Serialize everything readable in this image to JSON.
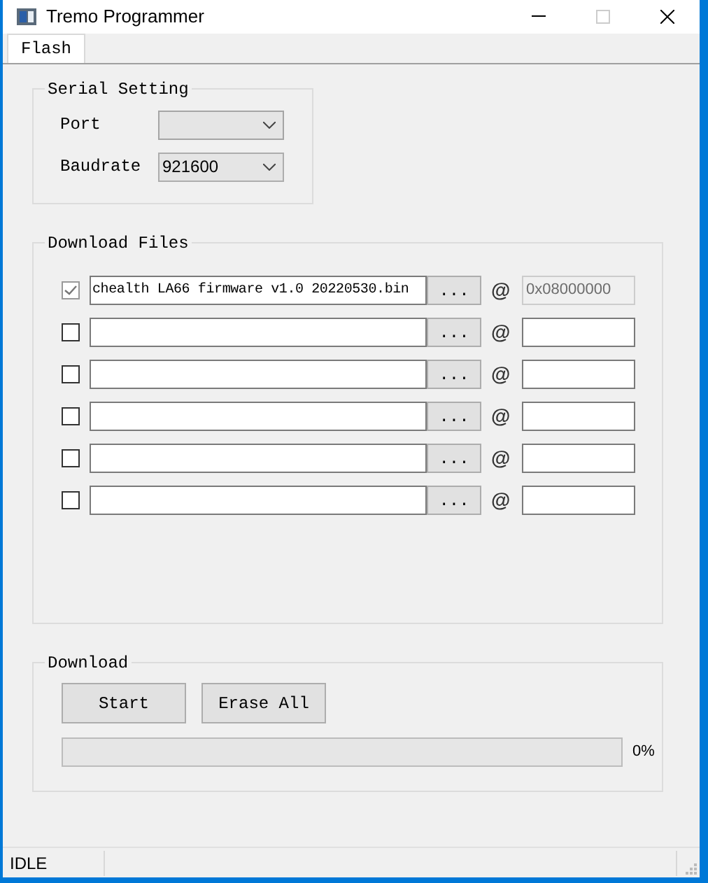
{
  "window": {
    "title": "Tremo Programmer"
  },
  "tabs": [
    {
      "label": "Flash",
      "selected": true
    }
  ],
  "serial_setting": {
    "title": "Serial Setting",
    "port": {
      "label": "Port"
    },
    "baudrate": {
      "label": "Baudrate",
      "value": "921600"
    }
  },
  "download_files": {
    "title": "Download Files",
    "rows": [
      {
        "checked": true,
        "file": "chealth LA66 firmware v1.0 20220530.bin",
        "browse": "...",
        "at": "@",
        "address": "0x08000000",
        "address_disabled": true
      },
      {
        "checked": false,
        "browse": "...",
        "at": "@",
        "address_disabled": false
      },
      {
        "checked": false,
        "browse": "...",
        "at": "@",
        "address_disabled": false
      },
      {
        "checked": false,
        "browse": "...",
        "at": "@",
        "address_disabled": false
      },
      {
        "checked": false,
        "browse": "...",
        "at": "@",
        "address_disabled": false
      },
      {
        "checked": false,
        "browse": "...",
        "at": "@",
        "address_disabled": false
      }
    ]
  },
  "download": {
    "title": "Download",
    "buttons": [
      "Start",
      "Erase All"
    ],
    "progress": {
      "level": 0,
      "reading": "0%"
    }
  },
  "status_bar": {
    "text": "IDLE"
  }
}
